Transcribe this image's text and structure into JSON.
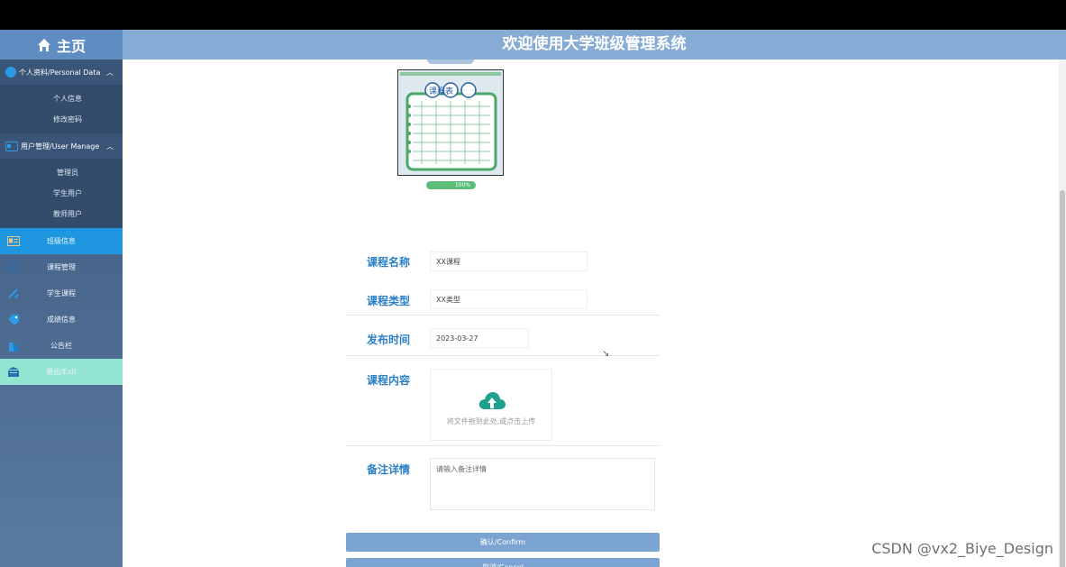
{
  "header": {
    "home_label": "主页",
    "title": "欢迎使用大学班级管理系统"
  },
  "sidebar": {
    "group_personal": {
      "label": "个人资料/Personal Data",
      "items": [
        "个人信息",
        "修改密码"
      ]
    },
    "group_users": {
      "label": "用户管理/User Manage",
      "items": [
        "管理员",
        "学生用户",
        "教师用户"
      ]
    },
    "nav": [
      {
        "label": "班级信息",
        "icon": "id-card-icon"
      },
      {
        "label": "课程管理",
        "icon": "globe-icon"
      },
      {
        "label": "学生课程",
        "icon": "tools-icon"
      },
      {
        "label": "成绩信息",
        "icon": "tag-icon"
      },
      {
        "label": "公告栏",
        "icon": "building-icon"
      },
      {
        "label": "退出/Exit",
        "icon": "inbox-icon"
      }
    ]
  },
  "form": {
    "upload_progress": "100%",
    "poster_title": "课程表",
    "course_name": {
      "label": "课程名称",
      "value": "XX课程"
    },
    "course_type": {
      "label": "课程类型",
      "value": "XX类型"
    },
    "publish_time": {
      "label": "发布时间",
      "value": "2023-03-27"
    },
    "course_content": {
      "label": "课程内容",
      "upload_hint": "将文件拖到此处,或点击上传"
    },
    "remarks": {
      "label": "备注详情",
      "placeholder": "请输入备注详情"
    },
    "confirm_label": "确认/Confirm",
    "cancel_label": "取消/Cancel"
  },
  "watermark": "CSDN @vx2_Biye_Design",
  "colors": {
    "header": "#86acd6",
    "accent": "#1f97e0",
    "label": "#2a7fc6",
    "button": "#7ba4d3",
    "progress": "#5bbf7a"
  }
}
